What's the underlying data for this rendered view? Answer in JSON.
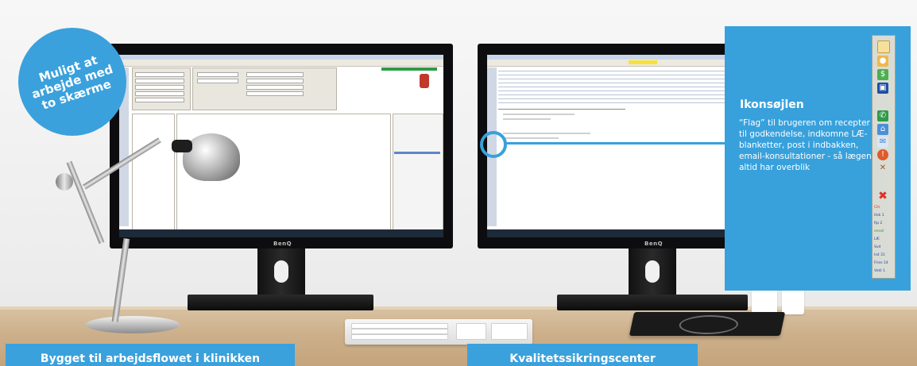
{
  "badge": {
    "text": "Muligt at\narbejde med\nto skærme"
  },
  "info": {
    "title": "Ikonsøjlen",
    "body": "“Flag” til brugeren om recepter til godkendelse, indkomne LÆ-blanketter, post i indbakken, email-konsultationer - så lægen altid har overblik"
  },
  "monitors": {
    "brand": "BenQ"
  },
  "footer": {
    "left": "Bygget til arbejdsflowet i klinikken",
    "right": "Kvalitetssikringscenter"
  },
  "iconbar": {
    "icons": [
      "window-icon",
      "person-icon",
      "money-icon",
      "monitor-icon",
      "phone-icon",
      "home-icon",
      "mail-icon",
      "alert-icon",
      "tools-icon",
      "close-icon"
    ],
    "labels": [
      "Cih",
      "Hsk 1",
      "Rp 2",
      "email",
      "LÆ",
      "Svd",
      "Isd 31",
      "Fries 14",
      "Vedi 1"
    ]
  },
  "colors": {
    "accent": "#38a1dc"
  }
}
